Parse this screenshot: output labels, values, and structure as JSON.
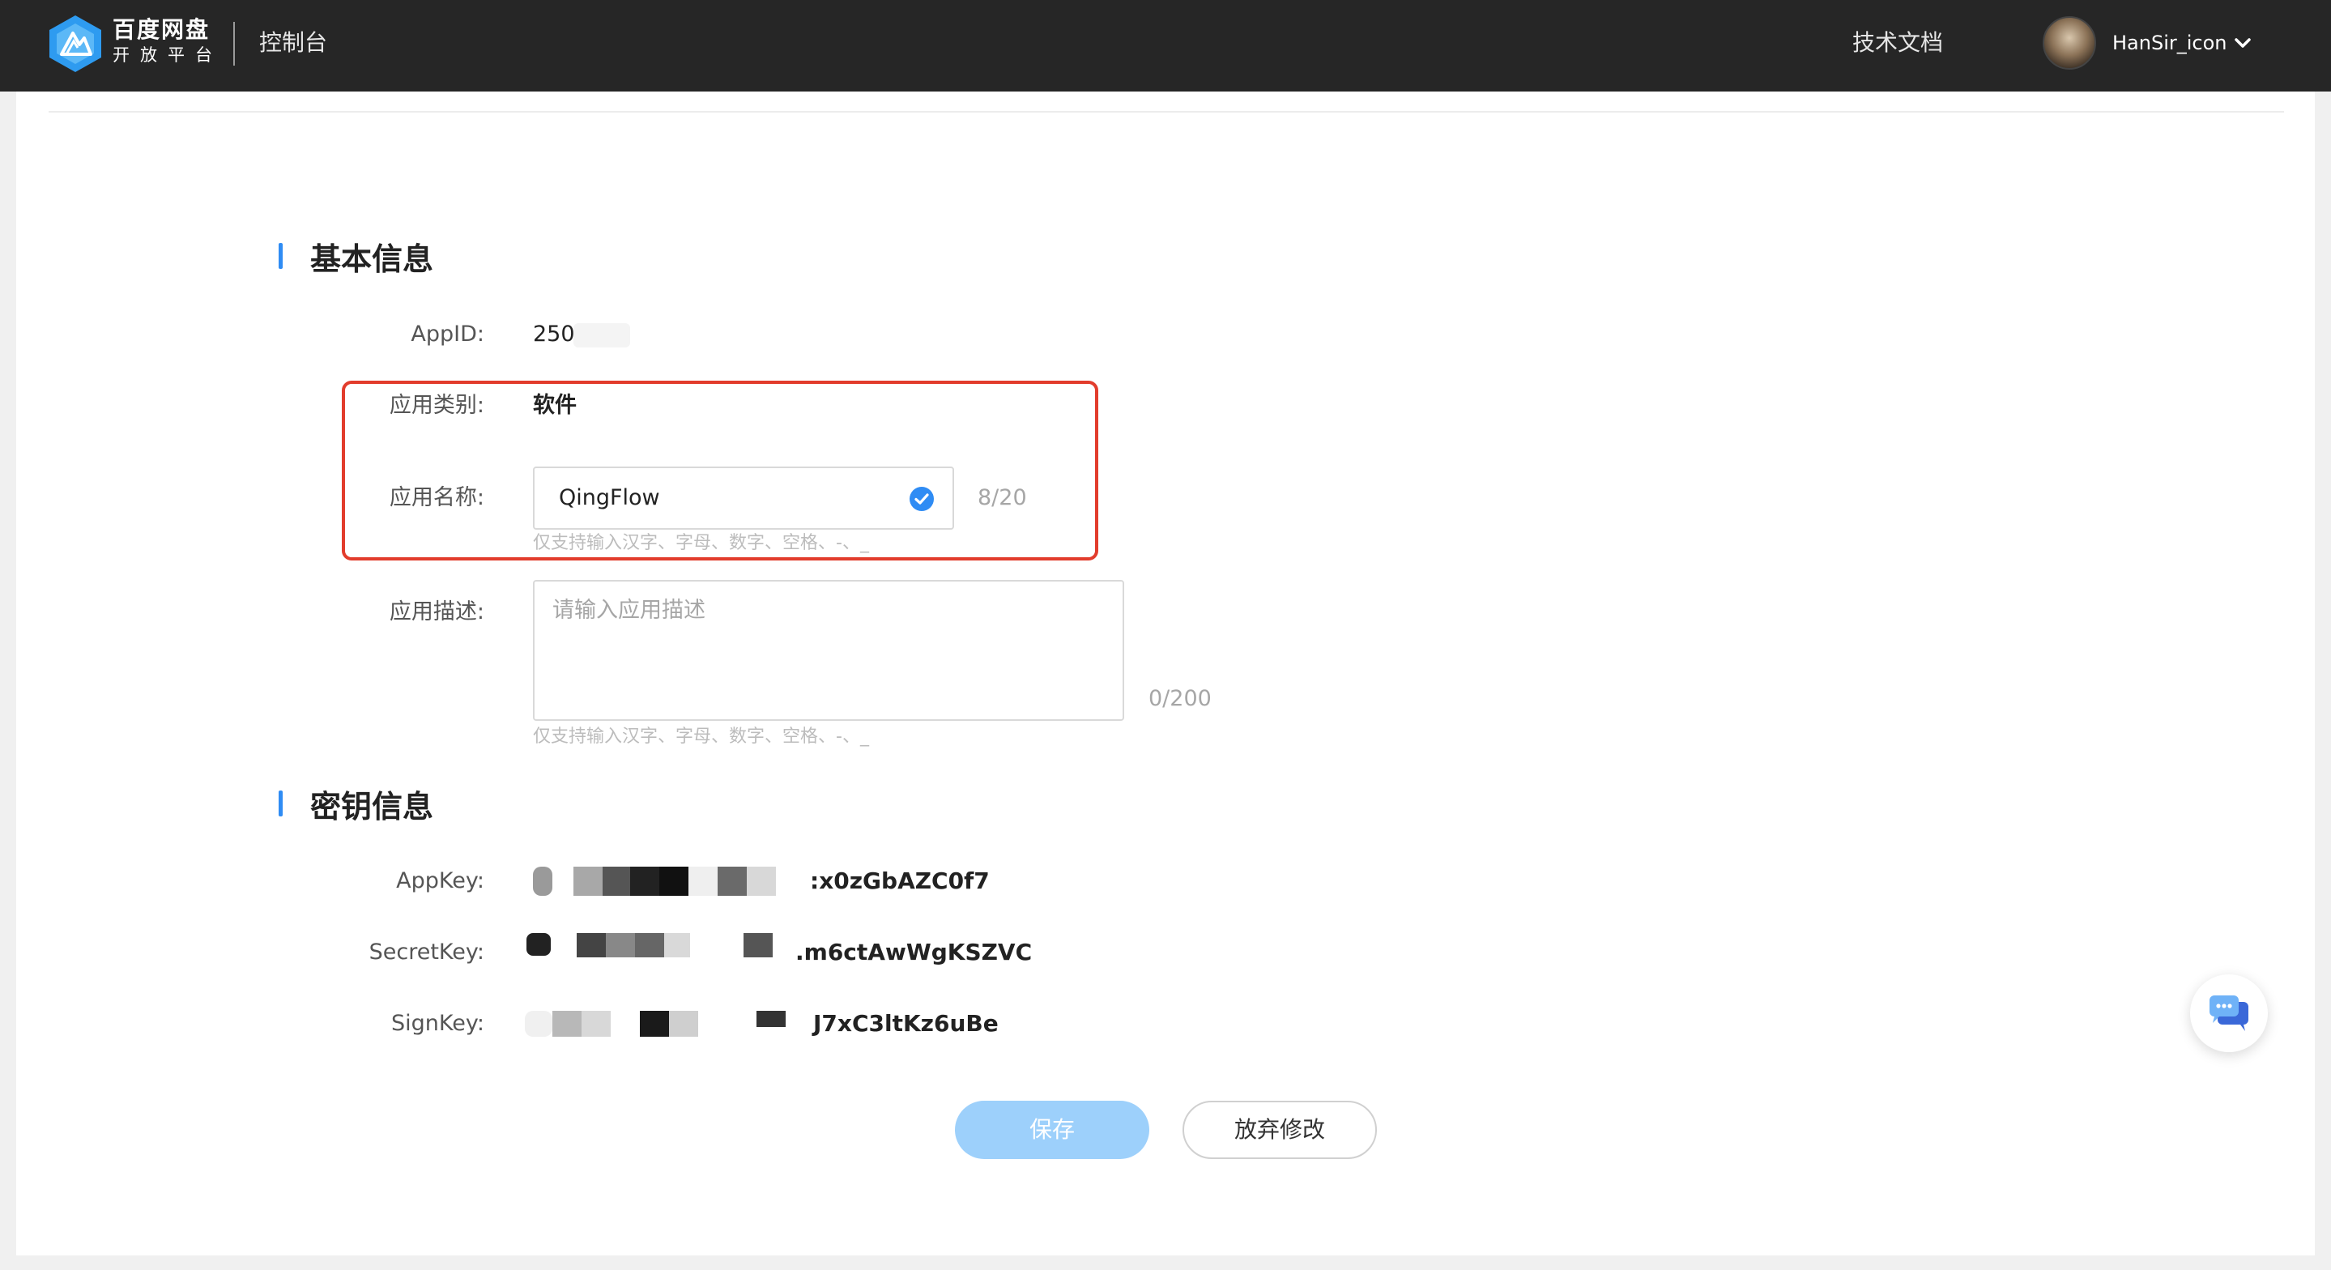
{
  "header": {
    "brand_main": "百度网盘",
    "brand_sub": "开放平台",
    "console_label": "控制台",
    "docs_link": "技术文档",
    "username": "HanSir_icon"
  },
  "colors": {
    "topbar": "#262626",
    "accent": "#2f8cf4",
    "highlight": "#e23c2c",
    "save_button": "#9dd0fb"
  },
  "basic_info": {
    "title": "基本信息",
    "app_id": {
      "label": "AppID:",
      "value": "250"
    },
    "app_category": {
      "label": "应用类别:",
      "value": "软件"
    },
    "app_name": {
      "label": "应用名称:",
      "value": "QingFlow",
      "counter": "8/20",
      "hint": "仅支持输入汉字、字母、数字、空格、-、_"
    },
    "app_desc": {
      "label": "应用描述:",
      "placeholder": "请输入应用描述",
      "counter": "0/200",
      "hint": "仅支持输入汉字、字母、数字、空格、-、_"
    }
  },
  "secret_info": {
    "title": "密钥信息",
    "app_key": {
      "label": "AppKey:",
      "visible_suffix": ":x0zGbAZC0f7"
    },
    "secret_key": {
      "label": "SecretKey:",
      "visible_suffix": ".m6ctAwWgKSZVC"
    },
    "sign_key": {
      "label": "SignKey:",
      "visible_suffix": "J7xC3ltKz6uBe"
    }
  },
  "actions": {
    "save": "保存",
    "discard": "放弃修改"
  },
  "icons": {
    "logo": "baidu-netdisk-logo-icon",
    "dropdown": "chevron-down-icon",
    "valid": "check-circle-icon",
    "chat": "chat-bubbles-icon"
  }
}
